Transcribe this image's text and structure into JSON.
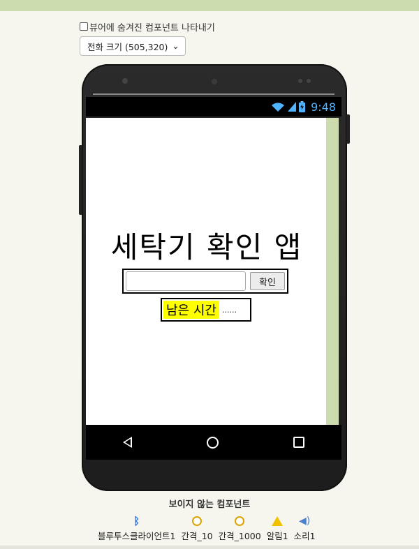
{
  "viewer": {
    "show_hidden_label": "뷰어에 숨겨진 컴포넌트 나타내기",
    "phone_size_option": "전화 크기 (505,320)"
  },
  "statusbar": {
    "time": "9:48"
  },
  "screen": {
    "title": "세탁기 확인 앱",
    "confirm_button": "확인",
    "remaining_label": "남은 시간",
    "remaining_value": "......"
  },
  "nonvisible": {
    "title": "보이지 않는 컴포넌트",
    "items": [
      {
        "label": "블루투스클라이언트1",
        "icon": "bluetooth-icon"
      },
      {
        "label": "간격_10",
        "icon": "clock-icon"
      },
      {
        "label": "간격_1000",
        "icon": "clock-icon"
      },
      {
        "label": "알림1",
        "icon": "warning-icon"
      },
      {
        "label": "소리1",
        "icon": "speaker-icon"
      }
    ]
  },
  "colors": {
    "accent_bar": "#cddcae",
    "label_highlight": "#ffff00",
    "clock_accent": "#4fb3ff"
  }
}
